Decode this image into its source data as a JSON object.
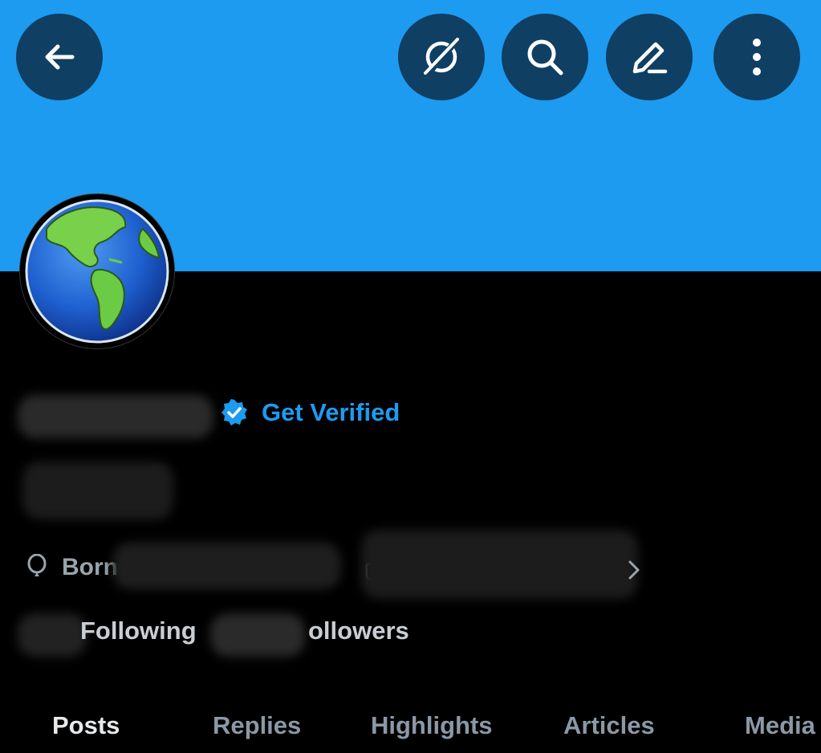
{
  "header": {
    "back_icon": "arrow-left-icon",
    "grok_icon": "grok-icon",
    "search_icon": "search-icon",
    "edit_icon": "pencil-icon",
    "more_icon": "more-vertical-icon",
    "banner_color": "#1d9bf0",
    "button_color": "#0f3f63"
  },
  "profile": {
    "verify_label": "Get Verified",
    "born_label": "Born",
    "following_label": "Following",
    "followers_label": "ollowers",
    "accent": "#1d9bf0"
  },
  "tabs": [
    {
      "label": "Posts",
      "active": true
    },
    {
      "label": "Replies",
      "active": false
    },
    {
      "label": "Highlights",
      "active": false
    },
    {
      "label": "Articles",
      "active": false
    },
    {
      "label": "Media",
      "active": false
    }
  ]
}
